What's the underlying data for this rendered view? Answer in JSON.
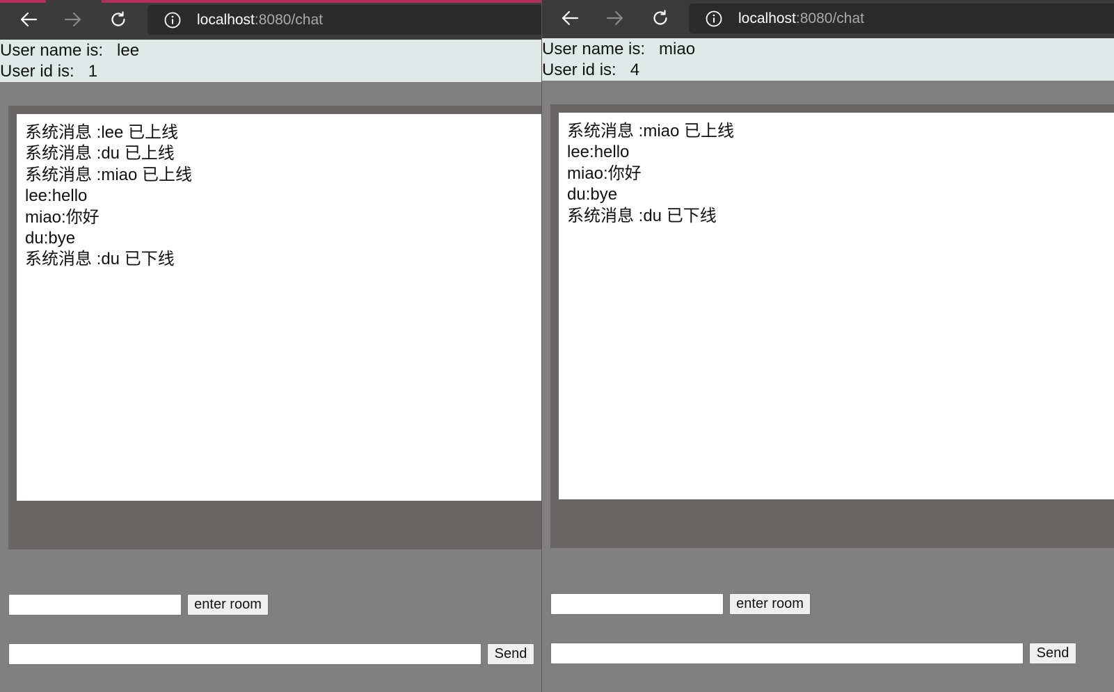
{
  "colors": {
    "toolbar_bg": "#3b3b3b",
    "urlbar_bg": "#2b2b2b",
    "accent": "#b3305a",
    "userinfo_bg": "#dfe9e8",
    "page_bg": "#808080",
    "chat_panel_bg": "#6a6565",
    "message_box_bg": "#ffffff"
  },
  "icons": {
    "back": "back-arrow-icon",
    "forward": "forward-arrow-icon",
    "reload": "reload-icon",
    "info": "info-icon"
  },
  "windows": [
    {
      "url": {
        "host": "localhost",
        "path": ":8080/chat"
      },
      "user": {
        "name_label": "User name is:   ",
        "name": "lee",
        "id_label": "User id is:   ",
        "id": "1"
      },
      "messages": [
        "系统消息 :lee 已上线",
        "系统消息 :du 已上线",
        "系统消息 :miao 已上线",
        "lee:hello",
        "miao:你好",
        "du:bye",
        "系统消息 :du 已下线"
      ],
      "room_input": {
        "value": "",
        "placeholder": ""
      },
      "enter_room_label": "enter room",
      "message_input": {
        "value": "",
        "placeholder": ""
      },
      "send_label": "Send"
    },
    {
      "url": {
        "host": "localhost",
        "path": ":8080/chat"
      },
      "user": {
        "name_label": "User name is:   ",
        "name": "miao",
        "id_label": "User id is:   ",
        "id": "4"
      },
      "messages": [
        "系统消息 :miao 已上线",
        "lee:hello",
        "miao:你好",
        "du:bye",
        "系统消息 :du 已下线"
      ],
      "room_input": {
        "value": "",
        "placeholder": ""
      },
      "enter_room_label": "enter room",
      "message_input": {
        "value": "",
        "placeholder": ""
      },
      "send_label": "Send"
    }
  ]
}
